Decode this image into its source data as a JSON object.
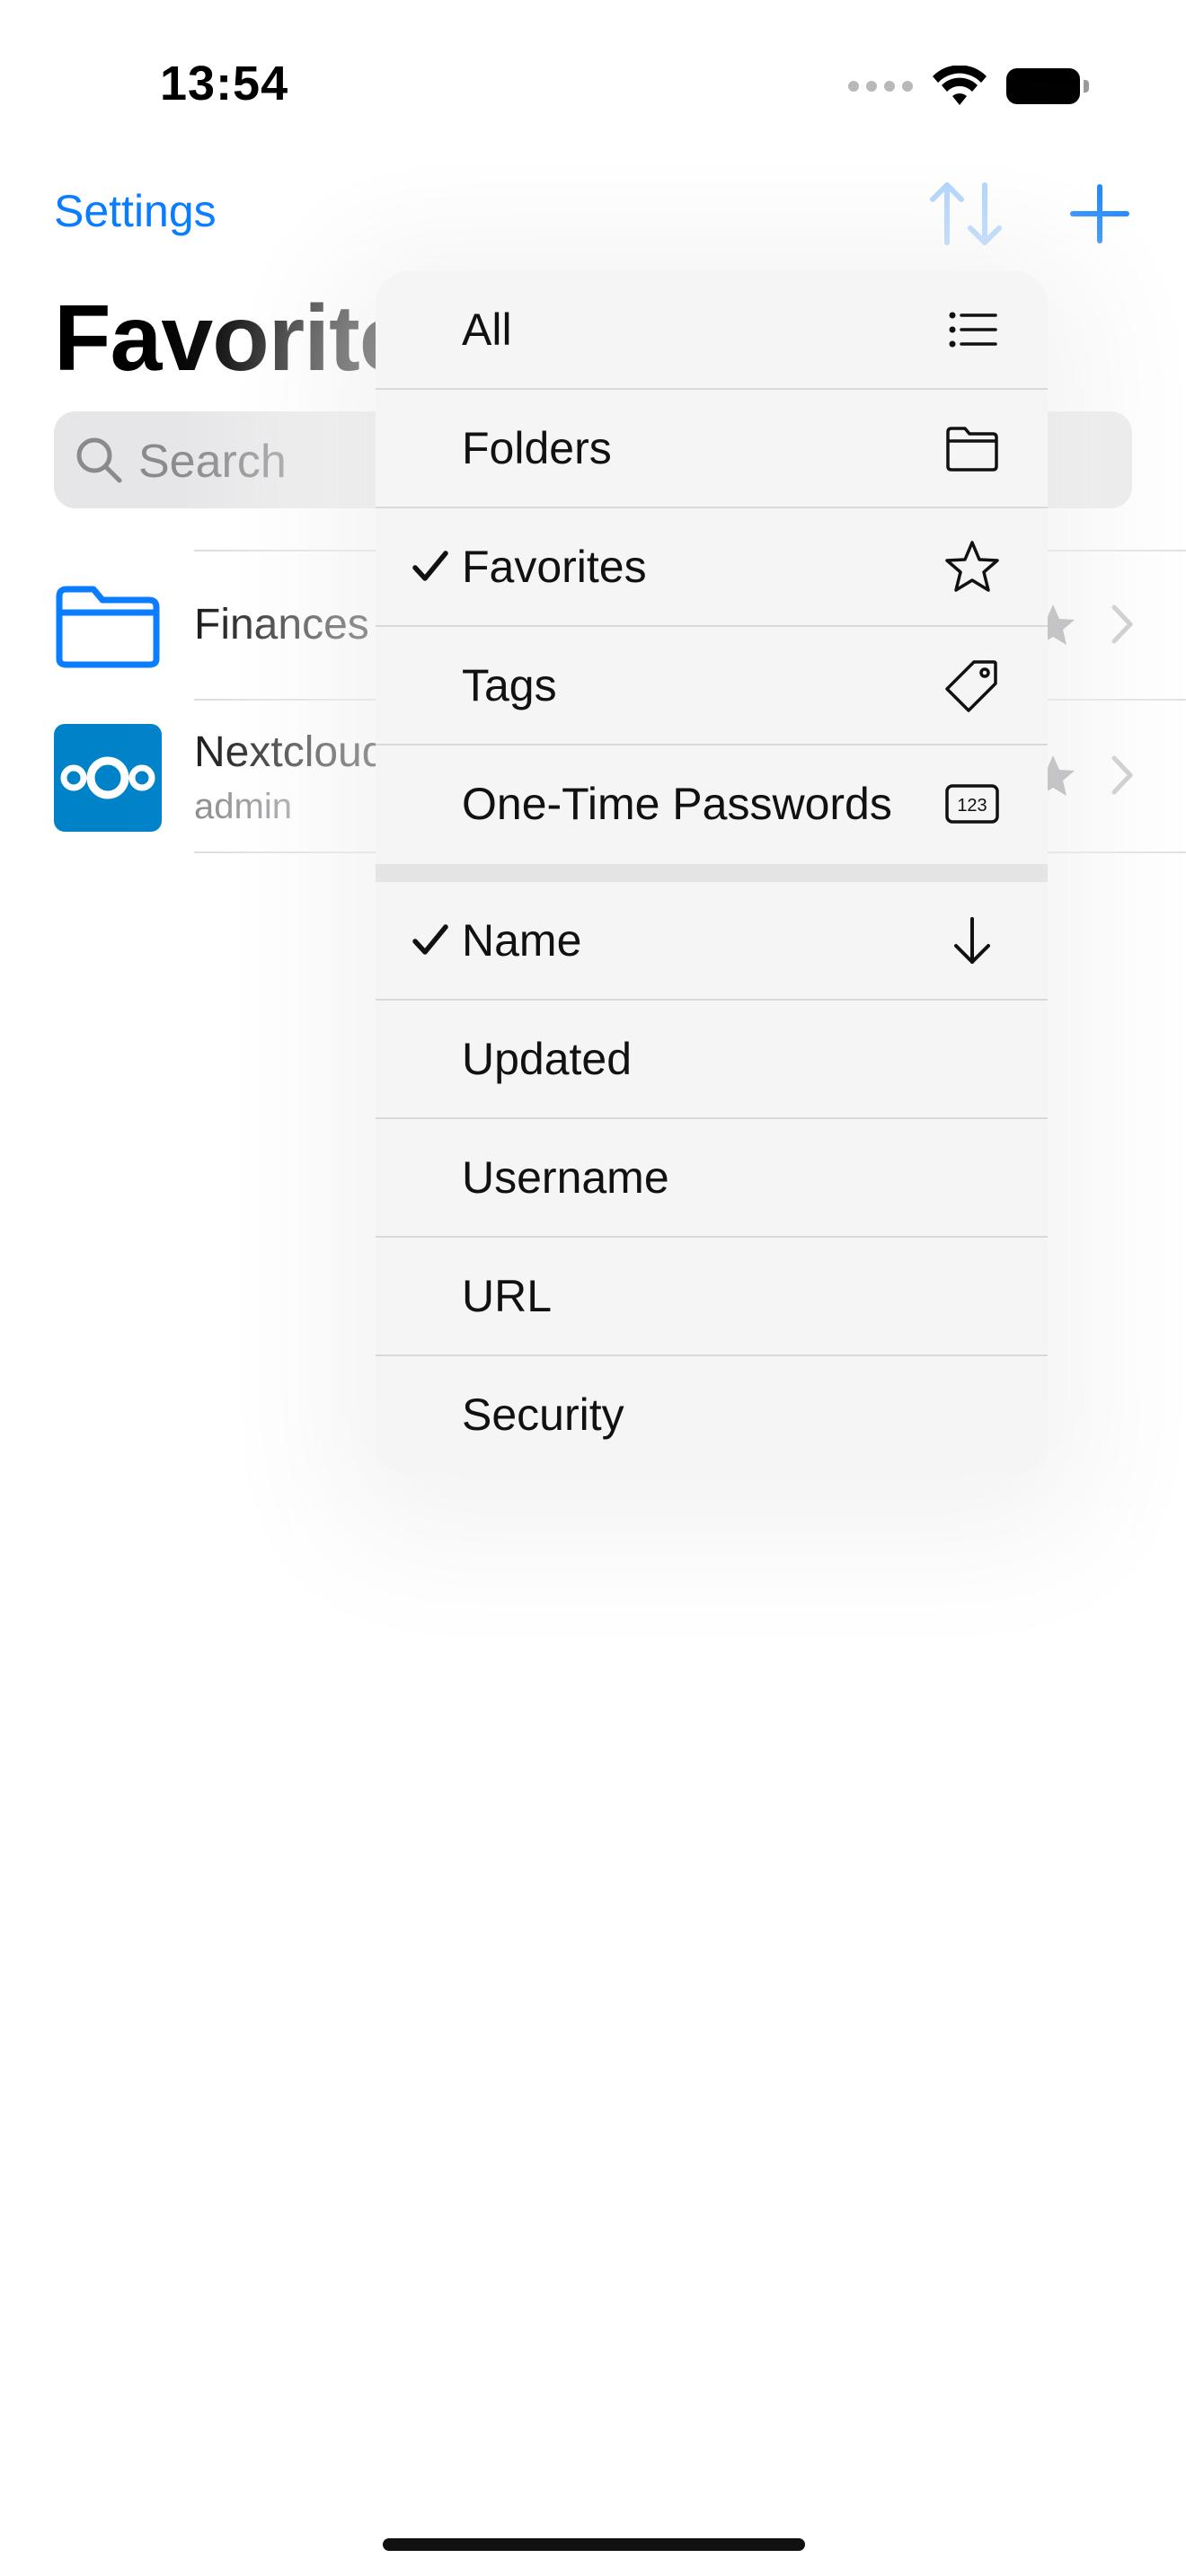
{
  "status_bar": {
    "time": "13:54"
  },
  "nav": {
    "settings_label": "Settings",
    "title": "Favorites"
  },
  "search": {
    "placeholder": "Search"
  },
  "list": {
    "items": [
      {
        "title": "Finances",
        "subtitle": ""
      },
      {
        "title": "Nextcloud",
        "subtitle": "admin"
      }
    ]
  },
  "menu": {
    "view_items": [
      {
        "label": "All",
        "icon": "list-icon",
        "checked": false
      },
      {
        "label": "Folders",
        "icon": "folder-icon",
        "checked": false
      },
      {
        "label": "Favorites",
        "icon": "star-icon",
        "checked": true
      },
      {
        "label": "Tags",
        "icon": "tag-icon",
        "checked": false
      },
      {
        "label": "One-Time Passwords",
        "icon": "number-123-icon",
        "checked": false
      }
    ],
    "sort_items": [
      {
        "label": "Name",
        "icon": "arrow-down-icon",
        "checked": true
      },
      {
        "label": "Updated",
        "icon": "",
        "checked": false
      },
      {
        "label": "Username",
        "icon": "",
        "checked": false
      },
      {
        "label": "URL",
        "icon": "",
        "checked": false
      },
      {
        "label": "Security",
        "icon": "",
        "checked": false
      }
    ]
  },
  "colors": {
    "accent": "#0a7cff",
    "nextcloud_brand": "#0082c9"
  }
}
